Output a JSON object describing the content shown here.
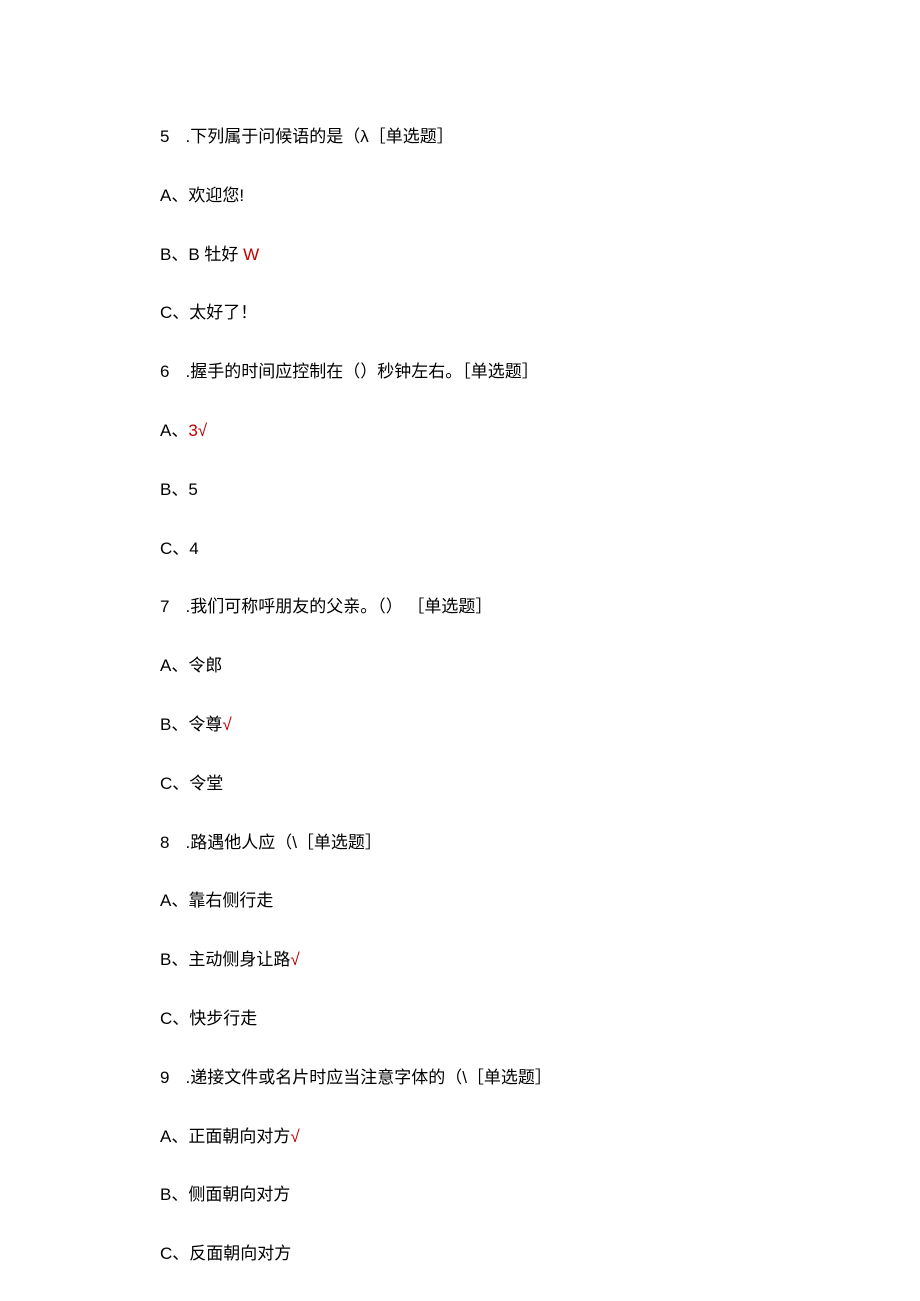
{
  "questions": [
    {
      "num": "5",
      "text": ".下列属于问候语的是（λ［单选题］",
      "options": [
        {
          "label": "A、欢迎您!",
          "mark": ""
        },
        {
          "label": "B、B 牡好 ",
          "mark": "W",
          "mark_class": "check-w"
        },
        {
          "label": "C、太好了！",
          "mark": ""
        }
      ]
    },
    {
      "num": "6",
      "text": ".握手的时间应控制在（）秒钟左右。［单选题］",
      "options": [
        {
          "label": "A、",
          "suffix": "3√",
          "suffix_class": "check"
        },
        {
          "label": "B、5",
          "mark": ""
        },
        {
          "label": "C、4",
          "mark": ""
        }
      ]
    },
    {
      "num": "7",
      "text": ".我们可称呼朋友的父亲。（） ［单选题］",
      "options": [
        {
          "label": "A、令郎",
          "mark": ""
        },
        {
          "label": "B、令尊",
          "mark": "√",
          "mark_class": "check"
        },
        {
          "label": "C、令堂",
          "mark": ""
        }
      ]
    },
    {
      "num": "8",
      "text": ".路遇他人应（\\［单选题］",
      "options": [
        {
          "label": "A、靠右侧行走",
          "mark": ""
        },
        {
          "label": "B、主动侧身让路",
          "mark": "√",
          "mark_class": "check"
        },
        {
          "label": "C、快步行走",
          "mark": ""
        }
      ]
    },
    {
      "num": "9",
      "text": ".递接文件或名片时应当注意字体的（\\［单选题］",
      "options": [
        {
          "label": "A、正面朝向对方",
          "mark": "√",
          "mark_class": "check"
        },
        {
          "label": "B、侧面朝向对方",
          "mark": ""
        },
        {
          "label": "C、反面朝向对方",
          "mark": ""
        }
      ]
    }
  ]
}
